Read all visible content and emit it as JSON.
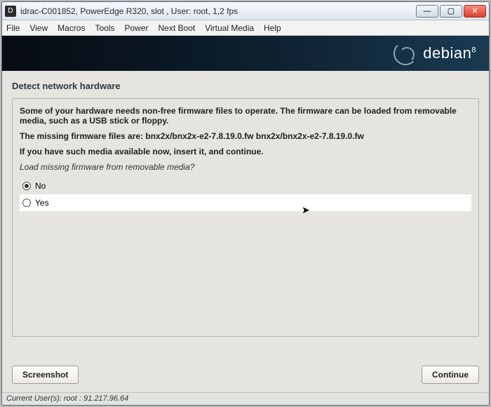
{
  "window": {
    "title": "idrac-C001852, PowerEdge R320,  slot , User: root, 1,2 fps",
    "icon_letter": "D"
  },
  "menubar": {
    "items": [
      "File",
      "View",
      "Macros",
      "Tools",
      "Power",
      "Next Boot",
      "Virtual Media",
      "Help"
    ]
  },
  "banner": {
    "brand": "debian",
    "version": "8"
  },
  "page": {
    "title": "Detect network hardware",
    "paragraph1": "Some of your hardware needs non-free firmware files to operate. The firmware can be loaded from removable media, such as a USB stick or floppy.",
    "missing_label": "The missing firmware files are: bnx2x/bnx2x-e2-7.8.19.0.fw bnx2x/bnx2x-e2-7.8.19.0.fw",
    "prompt_bold": "If you have such media available now, insert it, and continue.",
    "prompt_italic": "Load missing firmware from removable media?",
    "options": {
      "no": "No",
      "yes": "Yes"
    },
    "selected": "no"
  },
  "buttons": {
    "screenshot": "Screenshot",
    "continue": "Continue"
  },
  "statusbar": "Current User(s): root : 91.217.96.64"
}
